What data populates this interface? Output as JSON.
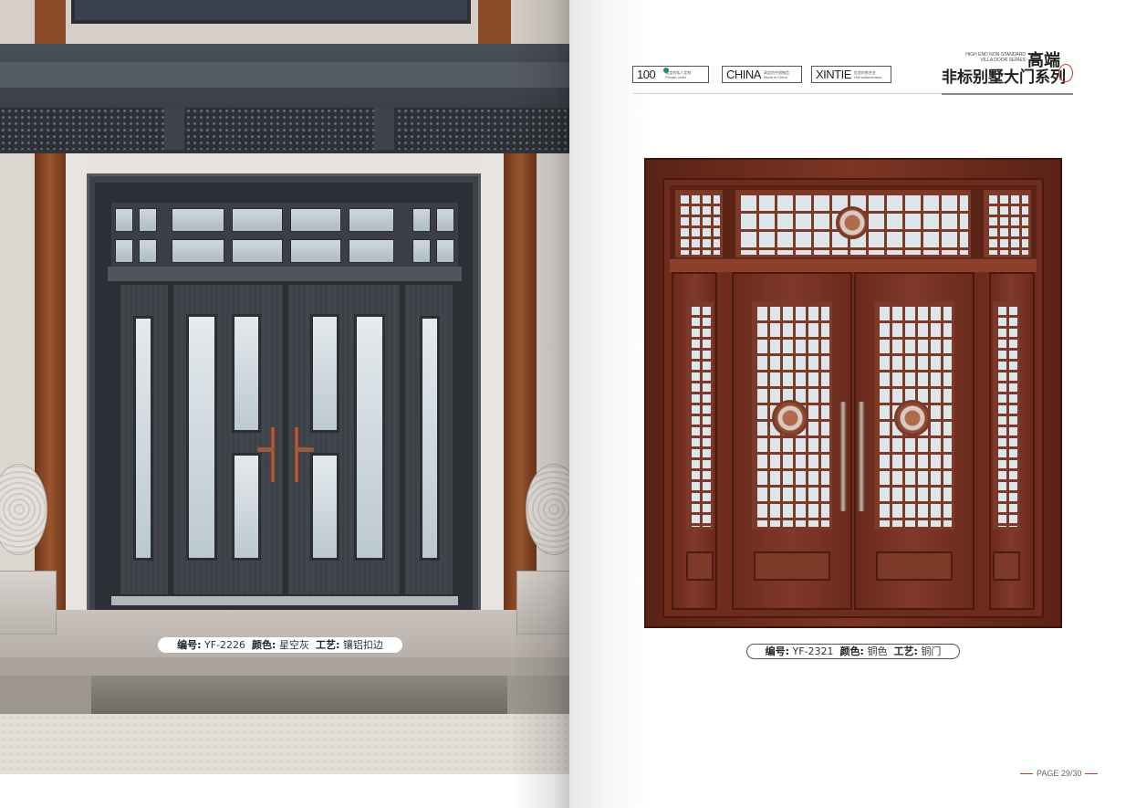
{
  "left_page": {
    "caption": {
      "code_label": "编号:",
      "code_value": "YF-2226",
      "color_label": "颜色:",
      "color_value": "星空灰",
      "craft_label": "工艺:",
      "craft_value": "镶铝扣边"
    }
  },
  "right_page": {
    "badges": [
      {
        "main": "100",
        "sub": "高定的私人定制",
        "sub2": "Private order"
      },
      {
        "main": "CHINA",
        "sub": "高定的中国制造",
        "sub2": "Made in China"
      },
      {
        "main": "XINTIE",
        "sub": "优质的铁合金",
        "sub2": "Hot-wallstainless"
      }
    ],
    "brand": {
      "en_line1": "HIGH END NON-STANDARD",
      "en_line2": "VILLA DOOR SERIES",
      "cn_top": "高端",
      "cn_main": "非标别墅大门系列",
      "seal": "印"
    },
    "caption": {
      "code_label": "编号:",
      "code_value": "YF-2321",
      "color_label": "颜色:",
      "color_value": "铜色",
      "craft_label": "工艺:",
      "craft_value": "铜门"
    },
    "page_number": "PAGE 29/30"
  },
  "colors": {
    "copper": "#7d3524",
    "grey_door": "#3d4147",
    "accent_red": "#c0392b"
  }
}
